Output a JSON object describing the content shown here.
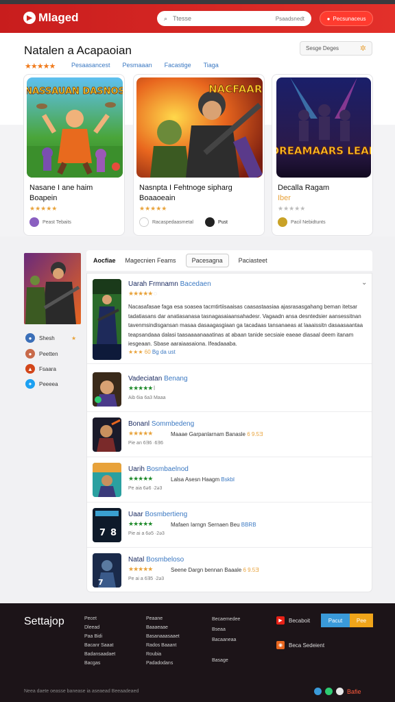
{
  "header": {
    "logo_text": "Mlaged",
    "search_placeholder": "Ttesse",
    "search_button": "Psaadsnedt",
    "top_button": "Pecsunaceus"
  },
  "hero": {
    "title": "Natalen a Acapaoian",
    "stars": "★★★★★",
    "links": [
      "Pesaasancest",
      "Pesmaaan",
      "Facastige",
      "Tiaga"
    ],
    "sort_label": "Sesge Deges"
  },
  "cards": [
    {
      "art_text": "NASSAUAN DASNOS",
      "name_line1": "Nasane I ane haim",
      "name_line2": "Boapein",
      "stars": "★★★★★",
      "meta": "Peast Tebaits"
    },
    {
      "art_text": "NACFAARA",
      "name_line1": "Nasnpta I Fehtnoge sipharg",
      "name_line2": "Boaaoeain",
      "stars": "★★★★★",
      "meta": "Racaspedaasmetal",
      "meta2": "Pust"
    },
    {
      "art_text": "DREAMAARS LEAK",
      "name_line1": "Decalla Ragam",
      "name_line2": "Iber",
      "stars": "★★★★★",
      "meta": "Pacil Nebidtunts"
    }
  ],
  "sidebar": {
    "items": [
      {
        "label": "Shesh",
        "badge": "★"
      },
      {
        "label": "Peetten"
      },
      {
        "label": "Fsaara"
      },
      {
        "label": "Peeeea"
      }
    ]
  },
  "tabs": {
    "label": "Aocfiae",
    "items": [
      "Magecnien Feams",
      "Pacesagna",
      "Paciasteet"
    ]
  },
  "list": [
    {
      "title": "Uarah Frmnamn",
      "subtitle": "Bacedaen",
      "stars": "★★★★★",
      "description": "Nacasafasae faga esa soasea tacmtirtiisaaisas caasastaasiaa ajasrasasgahang beman itetsar tadatiasans dar anatiasanasa tasnagasaiaansahadesr. Vagaadn ansa desntedsier aansessitnan tavenmsindisgansan masaa dasaagasgiaan ga tacadaas tansanaeas at laaaissitn dasaasaantaa teapsandaaa dalasi taasaaaanaaatinas at abaan tanide secsiaie eaeae diasaal deem itanam iesgeaan. Sbase aaraiaasaiona. Ifeadaaaba.",
      "rating_text": "★★★ 60",
      "tail": "Bg da ust"
    },
    {
      "title": "Vadeciatan",
      "subtitle": "Benang",
      "stars": "★★★★★",
      "stars_tail": "ǀ",
      "date": "Aib 6ia 6a3 Maaa",
      "tail": ""
    },
    {
      "title": "Bonanl",
      "subtitle": "Sommbedeng",
      "stars": "★★★★★",
      "tail": "Maaae Garpanlarnam Banasle",
      "tail_hl": "6 9.5Ǝ",
      "date": "Pie an 6Ǝ6 ·6Ǝ6"
    },
    {
      "title": "Uarih",
      "subtitle": "Bosmbaelnod",
      "stars": "★★★★★",
      "tail": "Lalsa Asesn Haagm",
      "tail_hl": "Bskbl",
      "date": "Pe aia 6ǝ6 ·2ǝ3"
    },
    {
      "title": "Uaar",
      "subtitle": "Bosmbertieng",
      "stars": "★★★★★",
      "tail": "Mafaen Iarngn Sernaen Beu",
      "tail_hl": "BBRB",
      "date": "Pie ai a 6ǝ5 ·2ǝ3"
    },
    {
      "title": "Natal",
      "subtitle": "Bosmbeloso",
      "stars": "★★★★★",
      "tail": "Seene Dargn bennan Baaale",
      "tail_hl": "6 9.5Ǝ",
      "date": "Pe ai a 6Ǝ5 ·2ǝ3"
    }
  ],
  "footer": {
    "brand": "Settajop",
    "col1": [
      "Pecet",
      "Dleead",
      "Paa Bidi",
      "Bacanr Saaat",
      "Badansaadaet",
      "Bacgas"
    ],
    "col2": [
      "Peaane",
      "Baaaeaae",
      "Basanaaasaaet",
      "Rados Baaant",
      "Roubia",
      "Padadodans"
    ],
    "col3": [
      "Becaemedee",
      "Bseaa",
      "Bacaaneaa",
      "",
      "Basage"
    ],
    "social1": "Becaboit",
    "social2": "Beca Sedeient",
    "btn1": "Pacut",
    "btn2": "Pee",
    "copyright": "Neea daete oeasse banease ia aseaead Beeaadeaed",
    "tail_text": "Bafie"
  },
  "colors": {
    "brand": "#d0221f",
    "accent_star": "#e8a23a",
    "link": "#3a78c2",
    "green_star": "#1e8a2a"
  }
}
